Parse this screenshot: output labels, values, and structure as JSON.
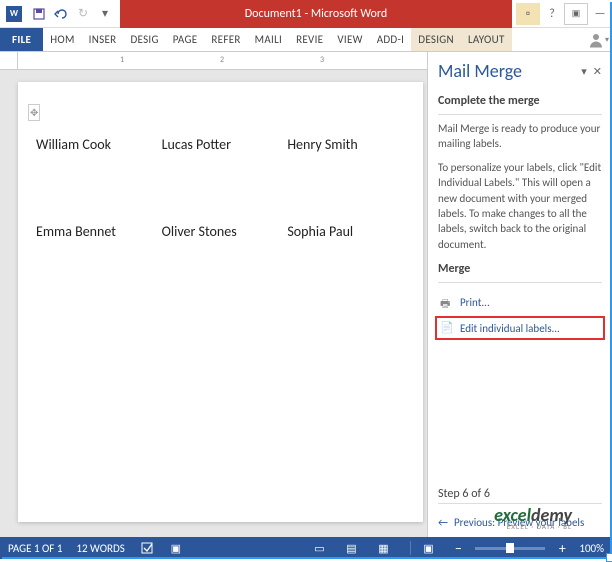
{
  "title": "Document1 - Microsoft Word",
  "tabs": {
    "file": "FILE",
    "home": "HOM",
    "insert": "INSER",
    "design": "DESIG",
    "page": "PAGE",
    "refer": "REFER",
    "mail": "MAILI",
    "review": "REVIE",
    "view": "VIEW",
    "addin": "ADD-I",
    "design2": "DESIGN",
    "layout": "LAYOUT"
  },
  "ruler": {
    "m1": "1",
    "m2": "2",
    "m3": "3"
  },
  "labels": [
    [
      "William Cook",
      "Lucas Potter",
      "Henry Smith"
    ],
    [
      "Emma Bennet",
      "Oliver Stones",
      "Sophia Paul"
    ]
  ],
  "pane": {
    "title": "Mail Merge",
    "complete_heading": "Complete the merge",
    "body1": "Mail Merge is ready to produce your mailing labels.",
    "body2": "To personalize your labels, click \"Edit Individual Labels.\" This will open a new document with your merged labels. To make changes to all the labels, switch back to the original document.",
    "merge_heading": "Merge",
    "print": "Print...",
    "edit": "Edit individual labels...",
    "step": "Step 6 of 6",
    "prev": "Previous: Preview your labels"
  },
  "status": {
    "page": "PAGE 1 OF 1",
    "words": "12 WORDS",
    "zoom": "100%"
  },
  "watermark": {
    "brand": "exceldemy",
    "sub": "EXCEL · DATA · BL"
  }
}
